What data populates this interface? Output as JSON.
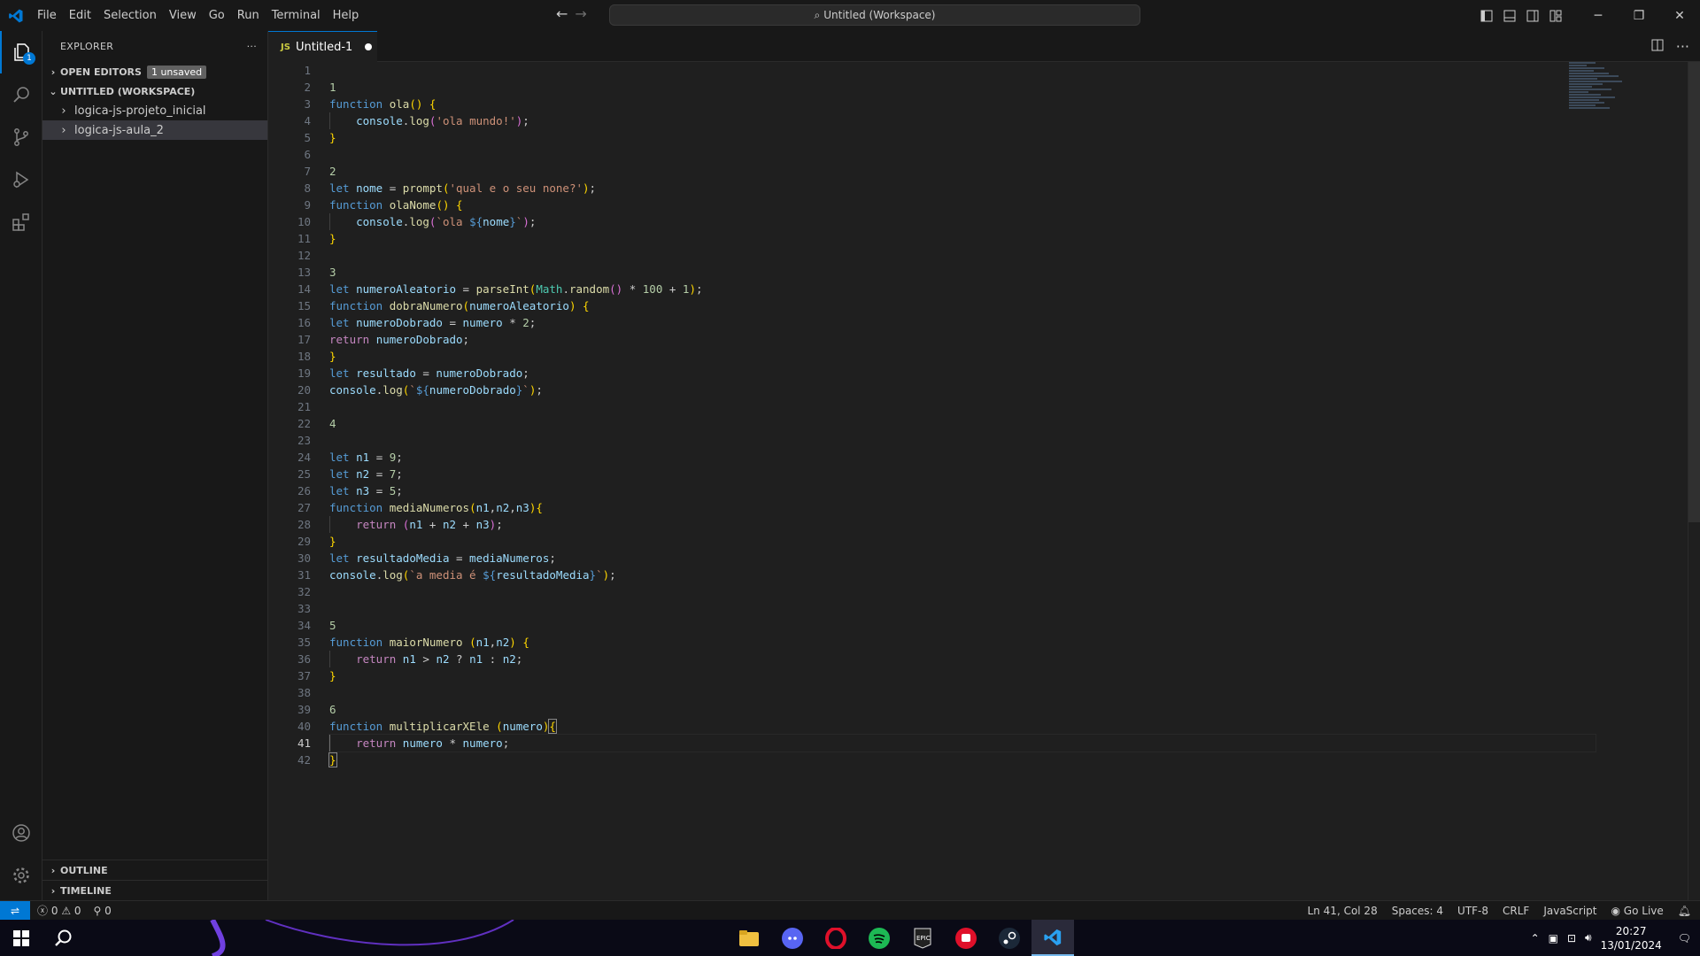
{
  "menu": [
    "File",
    "Edit",
    "Selection",
    "View",
    "Go",
    "Run",
    "Terminal",
    "Help"
  ],
  "command_center": "Untitled (Workspace)",
  "activity_badge": "1",
  "sidebar": {
    "title": "EXPLORER",
    "open_editors": "OPEN EDITORS",
    "unsaved_badge": "1 unsaved",
    "workspace": "UNTITLED (WORKSPACE)",
    "folders": [
      "logica-js-projeto_inicial",
      "logica-js-aula_2"
    ],
    "outline": "OUTLINE",
    "timeline": "TIMELINE"
  },
  "tab": {
    "icon_label": "JS",
    "title": "Untitled-1"
  },
  "editor": {
    "current_line": 41
  },
  "status": {
    "errors": "0",
    "warnings": "0",
    "ports": "0",
    "position": "Ln 41, Col 28",
    "spaces": "Spaces: 4",
    "encoding": "UTF-8",
    "eol": "CRLF",
    "language": "JavaScript",
    "golive": "Go Live"
  },
  "taskbar": {
    "time": "20:27",
    "date": "13/01/2024"
  }
}
